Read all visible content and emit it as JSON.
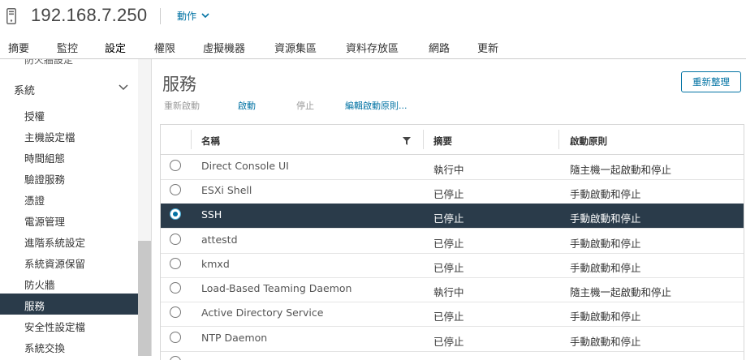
{
  "header": {
    "host": "192.168.7.250",
    "actions_label": "動作",
    "host_icon": "server-icon"
  },
  "tabs": [
    {
      "label": "摘要",
      "active": false
    },
    {
      "label": "監控",
      "active": false
    },
    {
      "label": "設定",
      "active": true
    },
    {
      "label": "權限",
      "active": false
    },
    {
      "label": "虛擬機器",
      "active": false
    },
    {
      "label": "資源集區",
      "active": false
    },
    {
      "label": "資料存放區",
      "active": false
    },
    {
      "label": "網路",
      "active": false
    },
    {
      "label": "更新",
      "active": false
    }
  ],
  "sidebar": {
    "cut_item": "防火牆設定",
    "group_label": "系統",
    "items": [
      {
        "label": "授權"
      },
      {
        "label": "主機設定檔"
      },
      {
        "label": "時間組態"
      },
      {
        "label": "驗證服務"
      },
      {
        "label": "憑證"
      },
      {
        "label": "電源管理"
      },
      {
        "label": "進階系統設定"
      },
      {
        "label": "系統資源保留"
      },
      {
        "label": "防火牆"
      },
      {
        "label": "服務"
      },
      {
        "label": "安全性設定檔"
      },
      {
        "label": "系統交換"
      }
    ],
    "active_index": 9
  },
  "main": {
    "title": "服務",
    "refresh_label": "重新整理",
    "toolbar": {
      "restart": "重新啟動",
      "start": "啟動",
      "stop": "停止",
      "edit_policy": "編輯啟動原則..."
    }
  },
  "table": {
    "columns": [
      "名稱",
      "摘要",
      "啟動原則"
    ],
    "rows": [
      {
        "name": "Direct Console UI",
        "status": "執行中",
        "policy": "隨主機一起啟動和停止",
        "selected": false
      },
      {
        "name": "ESXi Shell",
        "status": "已停止",
        "policy": "手動啟動和停止",
        "selected": false
      },
      {
        "name": "SSH",
        "status": "已停止",
        "policy": "手動啟動和停止",
        "selected": true
      },
      {
        "name": "attestd",
        "status": "已停止",
        "policy": "手動啟動和停止",
        "selected": false
      },
      {
        "name": "kmxd",
        "status": "已停止",
        "policy": "手動啟動和停止",
        "selected": false
      },
      {
        "name": "Load-Based Teaming Daemon",
        "status": "執行中",
        "policy": "隨主機一起啟動和停止",
        "selected": false
      },
      {
        "name": "Active Directory Service",
        "status": "已停止",
        "policy": "手動啟動和停止",
        "selected": false
      },
      {
        "name": "NTP Daemon",
        "status": "已停止",
        "policy": "手動啟動和停止",
        "selected": false
      }
    ]
  },
  "colors": {
    "accent": "#0072a3",
    "selected_bg": "#2a3b4a"
  }
}
